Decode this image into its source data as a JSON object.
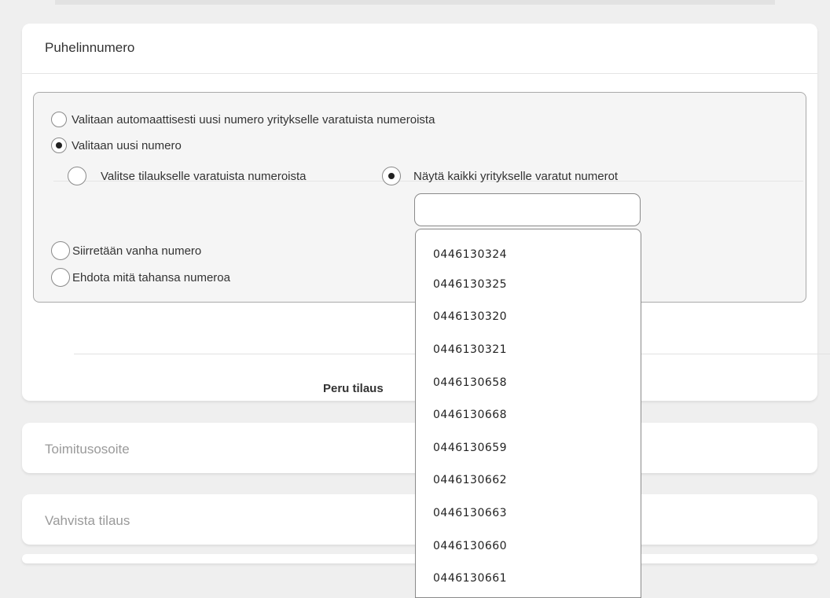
{
  "section_phone": {
    "title": "Puhelinnumero",
    "options": [
      {
        "label": "Valitaan automaattisesti uusi numero yritykselle varatuista numeroista",
        "checked": false
      },
      {
        "label": "Valitaan uusi numero",
        "checked": true
      },
      {
        "label": "Siirretään vanha numero",
        "checked": false
      },
      {
        "label": "Ehdota mitä tahansa numeroa",
        "checked": false
      }
    ],
    "sub_options": [
      {
        "label": "Valitse tilaukselle varatuista numeroista",
        "checked": false
      },
      {
        "label": "Näytä kaikki yritykselle varatut numerot",
        "checked": true
      }
    ],
    "search": {
      "value": "",
      "placeholder": ""
    },
    "cancel_label": "Peru tilaus"
  },
  "dropdown": {
    "items": [
      "0446130324",
      "0446130325",
      "0446130320",
      "0446130321",
      "0446130658",
      "0446130668",
      "0446130659",
      "0446130662",
      "0446130663",
      "0446130660",
      "0446130661"
    ]
  },
  "section_delivery": {
    "title": "Toimitusosoite"
  },
  "section_confirm": {
    "title": "Vahvista tilaus"
  },
  "icons": [
    "radio-unchecked-icon",
    "radio-checked-icon"
  ]
}
